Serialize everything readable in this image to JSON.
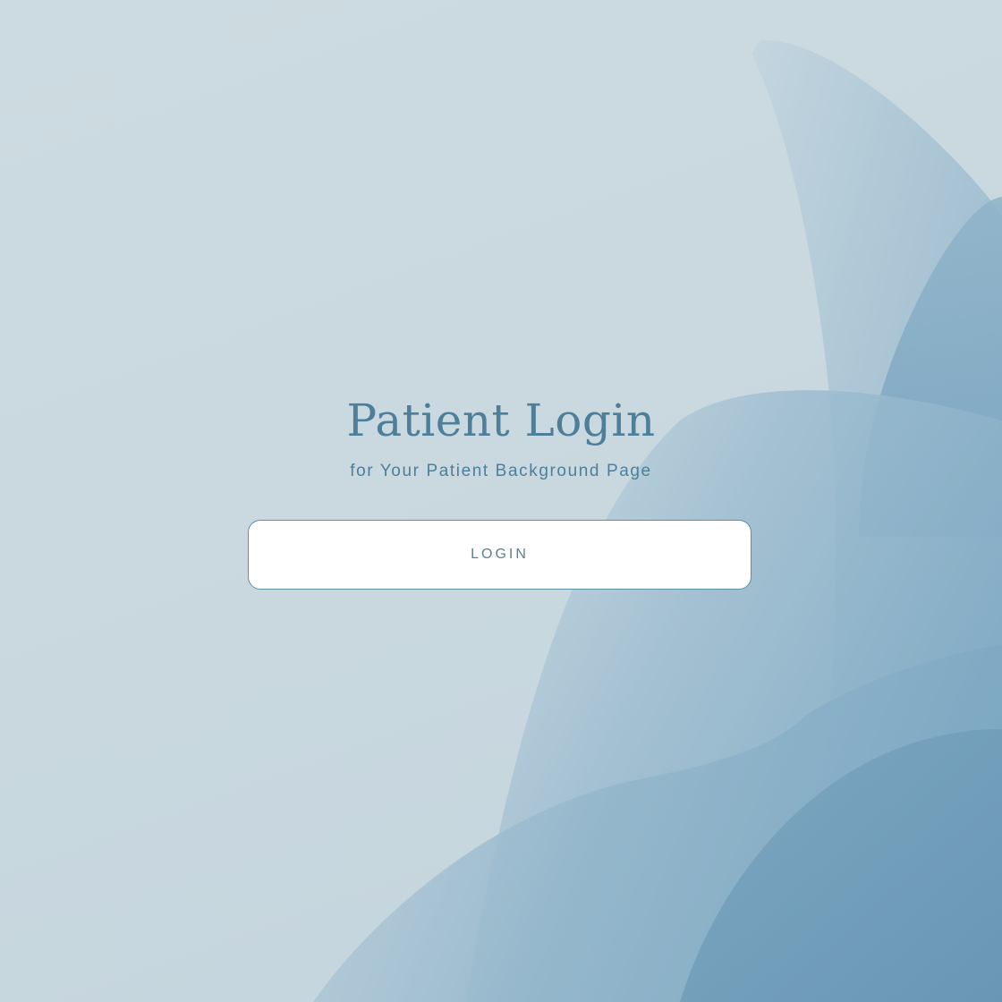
{
  "page": {
    "title": "Patient Login",
    "subtitle": "for Your Patient Background Page"
  },
  "actions": {
    "login_label": "LOGIN"
  },
  "colors": {
    "background": "#cddbe1",
    "accent_text": "#4d7f9a",
    "button_border": "#5f8ea6",
    "button_fill": "#ffffff",
    "wave_light": "#a9c3d2",
    "wave_mid": "#86aec5",
    "wave_dark": "#6d9bb8"
  }
}
